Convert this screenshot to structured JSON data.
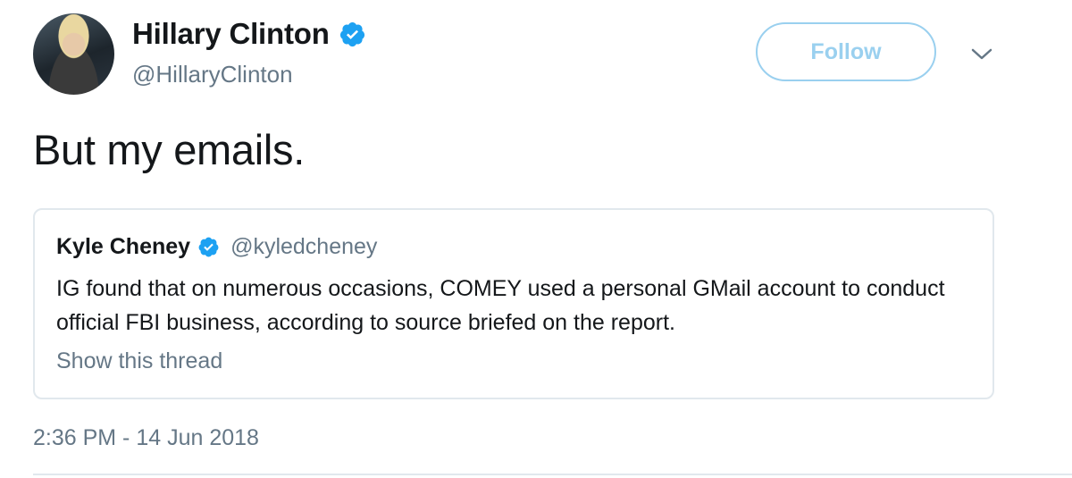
{
  "author": {
    "display_name": "Hillary Clinton",
    "handle": "@HillaryClinton",
    "verified_icon": "verified-badge-icon"
  },
  "follow_button": {
    "label": "Follow"
  },
  "menu": {
    "icon": "chevron-down-icon"
  },
  "tweet": {
    "text": "But my emails.",
    "timestamp": "2:36 PM - 14 Jun 2018"
  },
  "quoted_tweet": {
    "display_name": "Kyle Cheney",
    "handle": "@kyledcheney",
    "text": "IG found that on numerous occasions, COMEY used a personal GMail account to conduct official FBI business, according to source briefed on the report.",
    "show_thread_label": "Show this thread"
  },
  "colors": {
    "verified_blue": "#1da1f2",
    "follow_border": "#9ad0ef",
    "secondary_text": "#657786",
    "primary_text": "#14171a",
    "border": "#e1e8ed"
  }
}
